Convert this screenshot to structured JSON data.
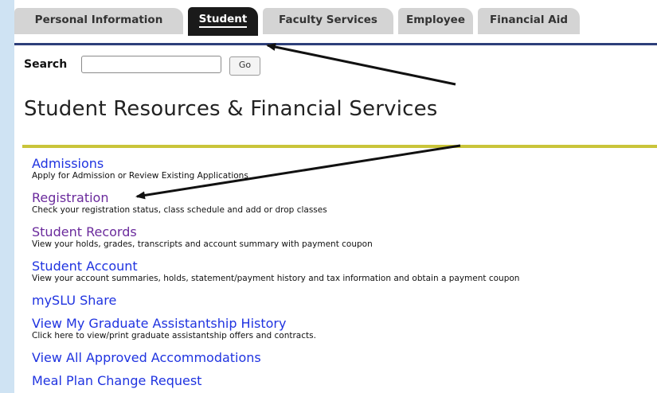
{
  "tabs": [
    {
      "label": "Personal Information",
      "active": false
    },
    {
      "label": "Student",
      "active": true
    },
    {
      "label": "Faculty Services",
      "active": false
    },
    {
      "label": "Employee",
      "active": false
    },
    {
      "label": "Financial Aid",
      "active": false
    }
  ],
  "search": {
    "label": "Search",
    "value": "",
    "button": "Go"
  },
  "page_title": "Student Resources & Financial Services",
  "links": [
    {
      "title": "Admissions",
      "desc": "Apply for Admission or Review Existing Applications",
      "visited": false
    },
    {
      "title": "Registration",
      "desc": "Check your registration status, class schedule and add or drop classes",
      "visited": true
    },
    {
      "title": "Student Records",
      "desc": "View your holds, grades, transcripts and account summary with payment coupon",
      "visited": true
    },
    {
      "title": "Student Account",
      "desc": "View your account summaries, holds, statement/payment history and tax information and obtain a payment coupon",
      "visited": false
    },
    {
      "title": "mySLU Share",
      "desc": "",
      "visited": false
    },
    {
      "title": "View My Graduate Assistantship History",
      "desc": "Click here to view/print graduate assistantship offers and contracts.",
      "visited": false
    },
    {
      "title": "View All Approved Accommodations",
      "desc": "",
      "visited": false
    },
    {
      "title": "Meal Plan Change Request",
      "desc": "",
      "visited": false
    }
  ],
  "colors": {
    "link": "#1f33e0",
    "visited_link": "#6a2a9c",
    "tab_active": "#1a1a1a",
    "tab_inactive": "#d4d4d4",
    "rule": "#c9c43a",
    "background": "#cfe3f3"
  }
}
